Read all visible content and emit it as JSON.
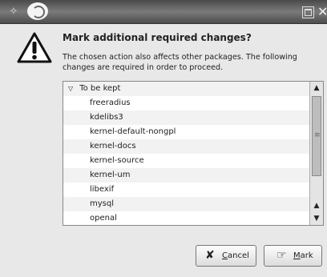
{
  "dialog": {
    "title": "Mark additional required changes?",
    "description": "The chosen action also affects other packages. The following changes are required in order to proceed."
  },
  "changes": {
    "group_label": "To be kept",
    "items": [
      "freeradius",
      "kdelibs3",
      "kernel-default-nongpl",
      "kernel-docs",
      "kernel-source",
      "kernel-um",
      "libexif",
      "mysql",
      "openal"
    ]
  },
  "buttons": {
    "cancel_first": "C",
    "cancel_rest": "ancel",
    "mark_first": "M",
    "mark_rest": "ark"
  }
}
